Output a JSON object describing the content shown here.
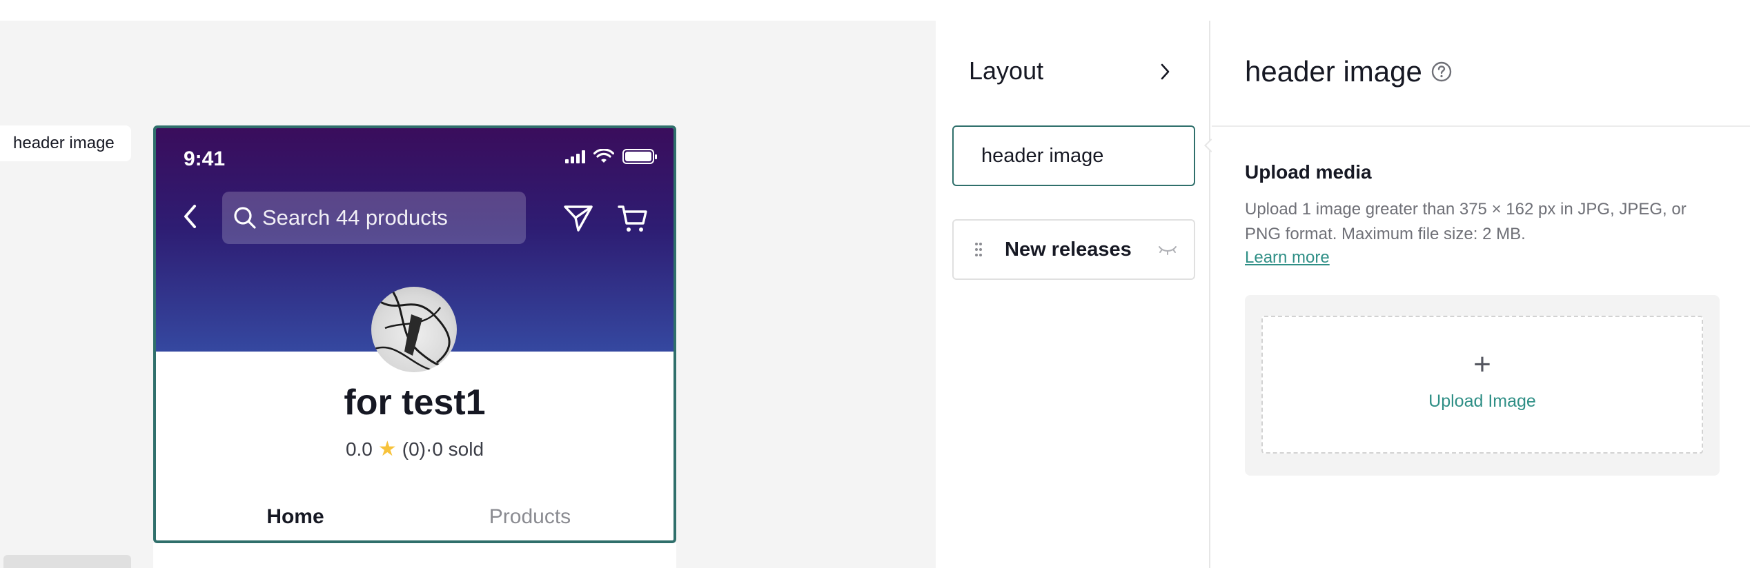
{
  "canvas": {
    "floating_label": "header image",
    "phone": {
      "status_time": "9:41",
      "search_placeholder": "Search 44 products",
      "shop_name": "for test1",
      "rating_score": "0.0",
      "rating_detail": "(0)·0 sold",
      "tabs": [
        {
          "label": "Home",
          "active": true
        },
        {
          "label": "Products",
          "active": false
        }
      ]
    }
  },
  "layout_panel": {
    "title": "Layout",
    "items": [
      {
        "label": "header image",
        "selected": true
      },
      {
        "label": "New releases",
        "selected": false
      }
    ]
  },
  "settings_panel": {
    "title": "header image",
    "upload_heading": "Upload media",
    "upload_description": "Upload 1 image greater than 375 × 162 px in JPG, JPEG, or PNG format. Maximum file size: 2 MB.",
    "learn_more": "Learn more",
    "upload_button": "Upload Image"
  },
  "colors": {
    "accent": "#2f6f6b",
    "link": "#2f8f86",
    "header_gradient_top": "#3a0d5c",
    "header_gradient_bottom": "#3548a0",
    "star": "#f7c23a"
  },
  "icons": [
    "chevron-left-icon",
    "search-icon",
    "send-icon",
    "cart-icon",
    "chevron-right-icon",
    "drag-handle-icon",
    "eye-hidden-icon",
    "help-icon",
    "plus-icon"
  ]
}
